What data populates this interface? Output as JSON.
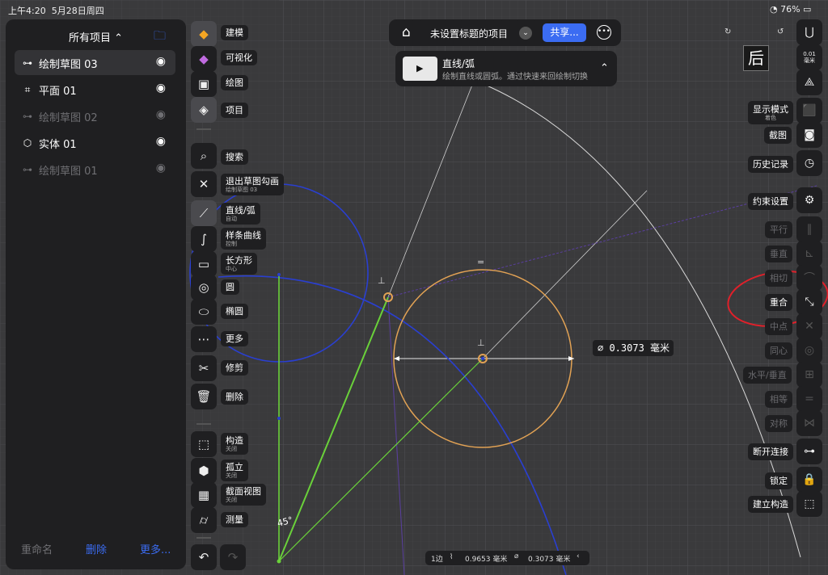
{
  "status_bar": {
    "time": "上午4:20",
    "date": "5月28日周四",
    "battery": "76%"
  },
  "left_panel": {
    "title": "所有项目 ⌃",
    "items": [
      {
        "label": "绘制草图 03",
        "icon": "sketch-icon",
        "visible": true,
        "selected": true
      },
      {
        "label": "平面  01",
        "icon": "plane-icon",
        "visible": true,
        "selected": false
      },
      {
        "label": "绘制草图 02",
        "icon": "sketch-icon",
        "visible": false,
        "selected": false
      },
      {
        "label": "实体  01",
        "icon": "solid-icon",
        "visible": true,
        "selected": false
      },
      {
        "label": "绘制草图 01",
        "icon": "sketch-icon",
        "visible": false,
        "selected": false
      }
    ],
    "footer": {
      "rename": "重命名",
      "delete": "删除",
      "more": "更多..."
    }
  },
  "toolbar": {
    "modeling": "建模",
    "visualize": "可视化",
    "drawing": "绘图",
    "project": "项目",
    "search": "搜索",
    "exit_sketch": "退出草图勾画",
    "exit_sketch_sub": "绘制草图 03",
    "line_arc": "直线/弧",
    "line_arc_sub": "自动",
    "spline": "样条曲线",
    "spline_sub": "控制",
    "rectangle": "长方形",
    "rectangle_sub": "中心",
    "circle": "圆",
    "ellipse": "椭圆",
    "more": "更多",
    "trim": "修剪",
    "delete": "删除",
    "construction": "构造",
    "construction_sub": "关闭",
    "isolate": "孤立",
    "isolate_sub": "关闭",
    "section_view": "截面视图",
    "section_view_sub": "关闭",
    "measure": "测量"
  },
  "top_bar": {
    "project_title": "未设置标题的项目",
    "share": "共享..."
  },
  "tooltip": {
    "title": "直线/弧",
    "description": "绘制直线或圆弧。通过快速来回绘制切换"
  },
  "view_cube": {
    "face": "后"
  },
  "right_panel": {
    "unit_value": "0.01",
    "unit": "毫米",
    "display_mode": "显示模式",
    "display_mode_sub": "着色",
    "screenshot": "截图",
    "history": "历史记录",
    "constraint_settings": "约束设置",
    "parallel": "平行",
    "perpendicular": "垂直",
    "tangent": "相切",
    "coincident": "重合",
    "midpoint": "中点",
    "concentric": "同心",
    "horizontal_vertical": "水平/垂直",
    "equal": "相等",
    "symmetric": "对称",
    "disconnect": "断开连接",
    "lock": "锁定",
    "make_construction": "建立构造"
  },
  "canvas": {
    "dimension_label": "⌀ 0.3073 毫米",
    "angle_label": "45°"
  },
  "bottom_bar": {
    "edges": "1边",
    "length": "0.9653 毫米",
    "diameter": "0.3073 毫米"
  },
  "colors": {
    "accent": "#3b6cf2",
    "sketch_blue": "#2a3fd0",
    "sketch_green": "#6ad13a",
    "circle_orange": "#e2a254",
    "annotation_red": "#e0202a"
  }
}
